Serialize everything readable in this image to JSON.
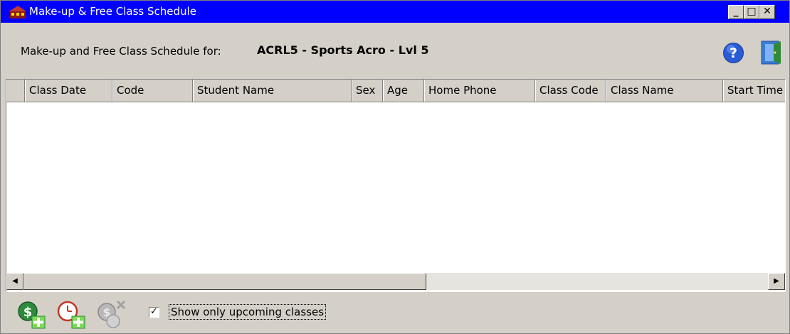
{
  "window": {
    "title": "Make-up & Free Class Schedule",
    "controls": {
      "minimize": "_",
      "maximize": "□",
      "close": "✕"
    }
  },
  "header": {
    "label": "Make-up and Free Class Schedule for:",
    "class_name": "ACRL5 - Sports Acro - Lvl 5",
    "help_icon": "help-icon",
    "exit_icon": "exit-door-icon"
  },
  "grid": {
    "columns": [
      "Class Date",
      "Code",
      "Student Name",
      "Sex",
      "Age",
      "Home Phone",
      "Class Code",
      "Class Name",
      "Start Time"
    ],
    "rows": []
  },
  "toolbar": {
    "buttons": [
      "add-makeup-icon",
      "add-free-class-icon",
      "remove-class-icon"
    ],
    "show_upcoming_label": "Show only upcoming classes",
    "show_upcoming_checked": true
  }
}
